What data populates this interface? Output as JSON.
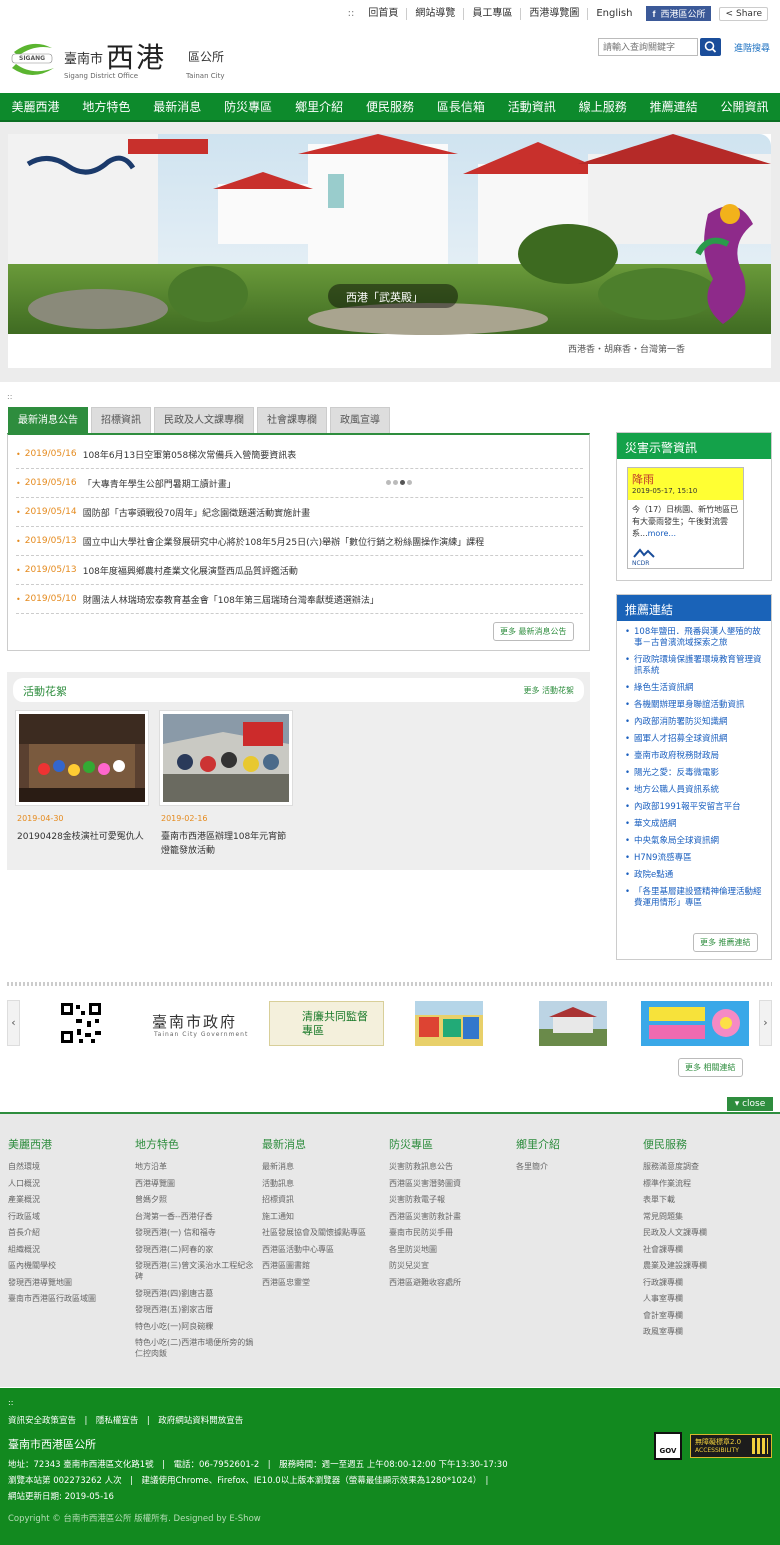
{
  "top": {
    "dots": "::",
    "links": [
      "回首頁",
      "網站導覽",
      "員工專區",
      "西港導覽圖",
      "English"
    ],
    "facebook": "西港區公所",
    "share": "Share"
  },
  "header": {
    "logo_city": "臺南市",
    "logo_main": "西港",
    "logo_office": "區公所",
    "logo_en_left": "Sigang District Office",
    "logo_en_right": "Tainan City",
    "logo_badge": "SIGANG",
    "search_placeholder": "請輸入查詢關鍵字",
    "advanced": "進階搜尋"
  },
  "nav": [
    "美麗西港",
    "地方特色",
    "最新消息",
    "防災專區",
    "鄉里介紹",
    "便民服務",
    "區長信箱",
    "活動資訊",
    "線上服務",
    "推薦連結",
    "公開資訊"
  ],
  "banner": {
    "caption": "西港「武英殿」",
    "slogan": "西港香・胡麻香・台灣第一香"
  },
  "tinydots": "::",
  "tabs": [
    "最新消息公告",
    "招標資訊",
    "民政及人文課專欄",
    "社會課專欄",
    "政風宣導"
  ],
  "news": [
    {
      "date": "2019/05/16",
      "title": "108年6月13日空軍第058梯次常備兵入營簡要資訊表"
    },
    {
      "date": "2019/05/16",
      "title": "「大專青年學生公部門暑期工讀計畫」"
    },
    {
      "date": "2019/05/14",
      "title": "國防部「古寧頭戰役70周年」紀念園徵題選活動實施計畫"
    },
    {
      "date": "2019/05/13",
      "title": "國立中山大學社會企業發展研究中心將於108年5月25日(六)舉辦「數位行銷之粉絲團操作演練」課程"
    },
    {
      "date": "2019/05/13",
      "title": "108年度福興鄉農村產業文化展演暨西瓜品質評鑑活動"
    },
    {
      "date": "2019/05/10",
      "title": "財團法人林瑞琦宏泰教育基金會「108年第三屆瑞琦台灣奉獻獎遴選辦法」"
    }
  ],
  "news_more": "更多 最新消息公告",
  "activity": {
    "title": "活動花絮",
    "more": "更多 活動花絮",
    "items": [
      {
        "date": "2019-04-30",
        "title": "20190428金枝演社可愛冤仇人"
      },
      {
        "date": "2019-02-16",
        "title": "臺南市西港區辦理108年元宵節燈籠發放活動"
      }
    ]
  },
  "disaster": {
    "title": "災害示警資訊",
    "type": "降雨",
    "time": "2019-05-17, 15:10",
    "text": "今（17）日桃園、新竹地區已有大豪雨發生；午後對流雲系...",
    "more": "more...",
    "logo": "NCDR"
  },
  "links": {
    "title": "推薦連結",
    "items": [
      "108年鹽田．飛番與漢人墾殖的故事－古曾濱流域探索之旅",
      "行政院環境保護署環境教育管理資訊系統",
      "綠色生活資訊網",
      "各機關辦理單身聯誼活動資訊",
      "內政部消防署防災知識網",
      "國軍人才招募全球資訊網",
      "臺南市政府稅務財政局",
      "陽光之愛：反毒微電影",
      "地方公職人員資訊系統",
      "內政部1991報平安留言平台",
      "華文成語網",
      "中央氣象局全球資訊網",
      "H7N9流感專區",
      "政院e點通",
      "「各里基層建設暨精神倫理活動經費運用情形」專區"
    ],
    "more": "更多 推薦連結"
  },
  "carousel": {
    "left": "‹",
    "right": "›",
    "tainan": "臺南市政府",
    "tainan_en": "Tainan City Government",
    "clean": "清廉共同監督專區",
    "more": "更多 相關連結"
  },
  "close": "▾ close",
  "footer_cols": [
    {
      "head": "美麗西港",
      "items": [
        "自然環境",
        "人口概況",
        "產業概況",
        "行政區域",
        "首長介紹",
        "組織概況",
        "區內機關學校",
        "發現西港導覽地圖",
        "臺南市西港區行政區域圖"
      ]
    },
    {
      "head": "地方特色",
      "items": [
        "地方沿革",
        "西港導覽圖",
        "曾媽夕照",
        "台灣第一香--西港仔香",
        "發現西港(一) 信和福寺",
        "發現西港(二)阿春的家",
        "發現西港(三)曾文溪治水工程紀念碑",
        "發現西港(四)劉唐古墓",
        "發現西港(五)劉家古厝",
        "特色小吃(一)阿良碗粿",
        "特色小吃(二)西港市場便所旁的鍋仁控肉飯"
      ]
    },
    {
      "head": "最新消息",
      "items": [
        "最新消息",
        "活動訊息",
        "招標資訊",
        "施工通知",
        "社區發展協會及關懷據點專區",
        "西港區活動中心專區",
        "西港區圖書館",
        "西港區忠靈堂"
      ]
    },
    {
      "head": "防災專區",
      "items": [
        "災害防救訊息公告",
        "西港區災害潛勢圖資",
        "災害防救電子報",
        "西港區災害防救計畫",
        "臺南市民防災手冊",
        "各里防災地圖",
        "防災兒災宣",
        "西港區避難收容處所"
      ]
    },
    {
      "head": "鄉里介紹",
      "items": [
        "各里簡介"
      ]
    },
    {
      "head": "便民服務",
      "items": [
        "服務滿意度調查",
        "標準作業流程",
        "表單下載",
        "常見問題集",
        "民政及人文課專欄",
        "社會課專欄",
        "農業及建設課專欄",
        "行政課專欄",
        "人事室專欄",
        "會計室專欄",
        "政風室專欄"
      ]
    }
  ],
  "bottom": {
    "dots": "::",
    "policy": "資訊安全政策宣告　|　隱私權宣告　|　政府網站資料開放宣告",
    "name": "臺南市西港區公所",
    "line1": "地址：72343 臺南市西港區文化路1號　|　電話：06-7952601-2　|　服務時間：週一至週五 上午08:00-12:00 下午13:30-17:30",
    "line2": "瀏覽本站第 002273262 人次　|　建議使用Chrome、Firefox、IE10.0以上版本瀏覽器（螢幕最佳顯示效果為1280*1024）　|",
    "line3": "網站更新日期: 2019-05-16",
    "copyright": "Copyright © 台南市西港區公所 版權所有. Designed by E-Show",
    "gov": "GOV",
    "a11y": "無障礙標章2.0",
    "a11y_en": "ACCESSIBILITY"
  },
  "colors": {
    "green": "#0d8a2c",
    "dark_green": "#12891f",
    "orange": "#e58b1f",
    "link_blue": "#1a5fbf"
  }
}
